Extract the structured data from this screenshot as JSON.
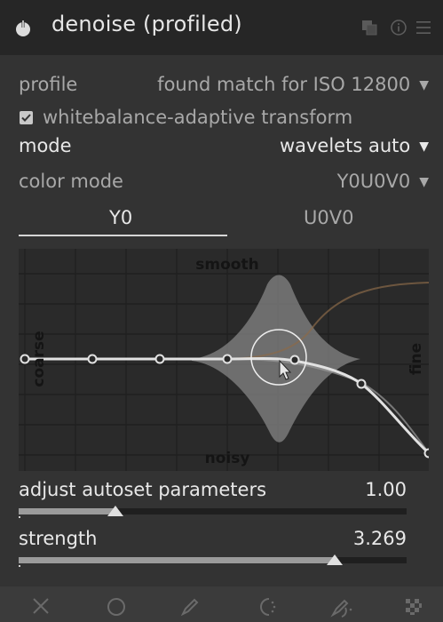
{
  "header": {
    "title": "denoise (profiled)",
    "icons": [
      "power-icon",
      "presets-icon",
      "info-icon",
      "menu-icon"
    ]
  },
  "profile": {
    "label": "profile",
    "value": "found match for ISO 12800"
  },
  "whitebalance": {
    "label": "whitebalance-adaptive transform",
    "checked": true
  },
  "mode": {
    "label": "mode",
    "value": "wavelets auto"
  },
  "color_mode": {
    "label": "color mode",
    "value": "Y0U0V0"
  },
  "tabs": [
    {
      "label": "Y0",
      "active": true
    },
    {
      "label": "U0V0",
      "active": false
    }
  ],
  "graph": {
    "top_label": "smooth",
    "bottom_label": "noisy",
    "left_label": "coarse",
    "right_label": "fine"
  },
  "sliders": [
    {
      "label": "adjust autoset parameters",
      "value": "1.00",
      "fraction": 0.25
    },
    {
      "label": "strength",
      "value": "3.269",
      "fraction": 0.815
    }
  ],
  "bottom_bar": {
    "icons": [
      "blend-off-icon",
      "uniform-blend-icon",
      "drawn-mask-icon",
      "parametric-mask-icon",
      "drawn-parametric-mask-icon",
      "raster-mask-icon"
    ]
  },
  "colors": {
    "accent_curve": "#e0e0e0",
    "secondary_curve": "#8a6a48",
    "background": "#333333"
  }
}
